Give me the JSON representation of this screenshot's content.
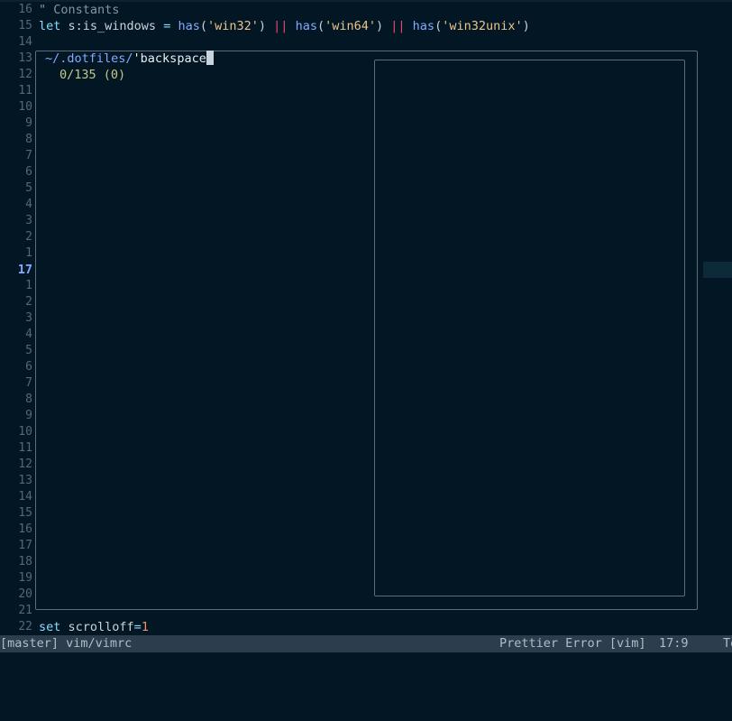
{
  "editor": {
    "top_lines": [
      {
        "num": "16",
        "tokens": [
          {
            "t": "\" Constants",
            "c": "c-comment"
          }
        ]
      },
      {
        "num": "15",
        "tokens": [
          {
            "t": "let ",
            "c": "c-kw"
          },
          {
            "t": "s:is_windows ",
            "c": "c-var"
          },
          {
            "t": "= ",
            "c": "c-op"
          },
          {
            "t": "has",
            "c": "c-fn"
          },
          {
            "t": "(",
            "c": "c-var"
          },
          {
            "t": "'win32'",
            "c": "c-str"
          },
          {
            "t": ") ",
            "c": "c-var"
          },
          {
            "t": "||",
            "c": "c-bar"
          },
          {
            "t": " ",
            "c": "c-var"
          },
          {
            "t": "has",
            "c": "c-fn"
          },
          {
            "t": "(",
            "c": "c-var"
          },
          {
            "t": "'win64'",
            "c": "c-str"
          },
          {
            "t": ") ",
            "c": "c-var"
          },
          {
            "t": "||",
            "c": "c-bar"
          },
          {
            "t": " ",
            "c": "c-var"
          },
          {
            "t": "has",
            "c": "c-fn"
          },
          {
            "t": "(",
            "c": "c-var"
          },
          {
            "t": "'win32unix'",
            "c": "c-str"
          },
          {
            "t": ")",
            "c": "c-var"
          }
        ]
      }
    ],
    "gutter_numbers": [
      "14",
      "13",
      "12",
      "11",
      "10",
      "9",
      "8",
      "7",
      "6",
      "5",
      "4",
      "3",
      "2",
      "1",
      "17",
      "1",
      "2",
      "3",
      "4",
      "5",
      "6",
      "7",
      "8",
      "9",
      "10",
      "11",
      "12",
      "13",
      "14",
      "15",
      "16",
      "17",
      "18",
      "19",
      "20",
      "21"
    ],
    "current_line_number": "17",
    "bottom_line": {
      "num": "22",
      "tokens": [
        {
          "t": "set ",
          "c": "c-kw"
        },
        {
          "t": "scrolloff",
          "c": "c-var"
        },
        {
          "t": "=",
          "c": "c-op"
        },
        {
          "t": "1",
          "c": "c-num"
        }
      ]
    }
  },
  "fzf": {
    "prompt_path": "~/.dotfiles/",
    "query": "'backspace",
    "match_count": "0/135 (0)"
  },
  "statusline": {
    "left": "[master] vim/vimrc",
    "filetype_status": "Prettier Error [vim]",
    "position": "17:9",
    "clipped": "To"
  }
}
